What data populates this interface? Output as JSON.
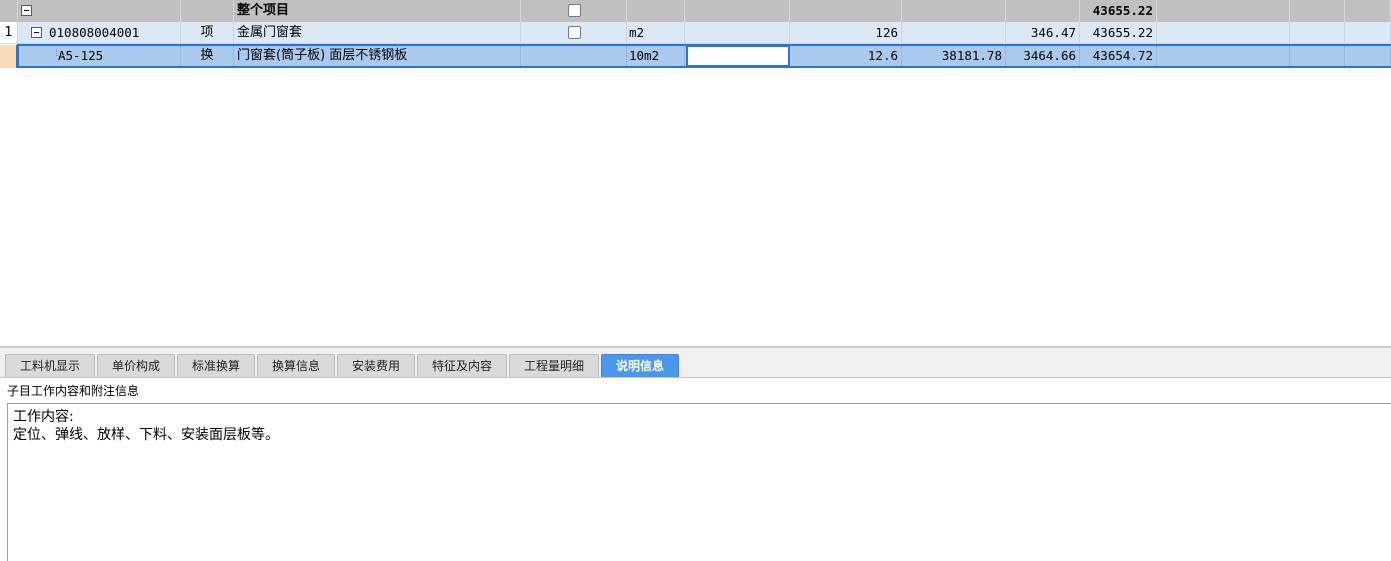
{
  "grid": {
    "summary": {
      "name": "整个项目",
      "total": "43655.22"
    },
    "item": {
      "row_number": "1",
      "code": "010808004001",
      "type": "项",
      "name": "金属门窗套",
      "unit": "m2",
      "quantity": "126",
      "col_c2": "346.47",
      "col_c3": "43655.22"
    },
    "subitem": {
      "code": "A5-125",
      "type": "换",
      "name": "门窗套(筒子板) 面层不锈钢板",
      "unit": "10m2",
      "expression": "",
      "quantity": "12.6",
      "col_c1": "38181.78",
      "col_c2": "3464.66",
      "col_c3": "43654.72"
    }
  },
  "tabs": [
    {
      "label": "工料机显示"
    },
    {
      "label": "单价构成"
    },
    {
      "label": "标准换算"
    },
    {
      "label": "换算信息"
    },
    {
      "label": "安装费用"
    },
    {
      "label": "特征及内容"
    },
    {
      "label": "工程量明细"
    },
    {
      "label": "说明信息",
      "active": true
    }
  ],
  "panel": {
    "caption": "子目工作内容和附注信息",
    "lines": [
      "工作内容:",
      "定位、弹线、放样、下料、安装面层板等。"
    ]
  },
  "colors": {
    "accent": "#2c73d2",
    "active_tab": "#4a97f0",
    "summary_row": "#c0c0c0",
    "item_row": "#dde8f7",
    "selected_row": "#a9c9ef"
  }
}
